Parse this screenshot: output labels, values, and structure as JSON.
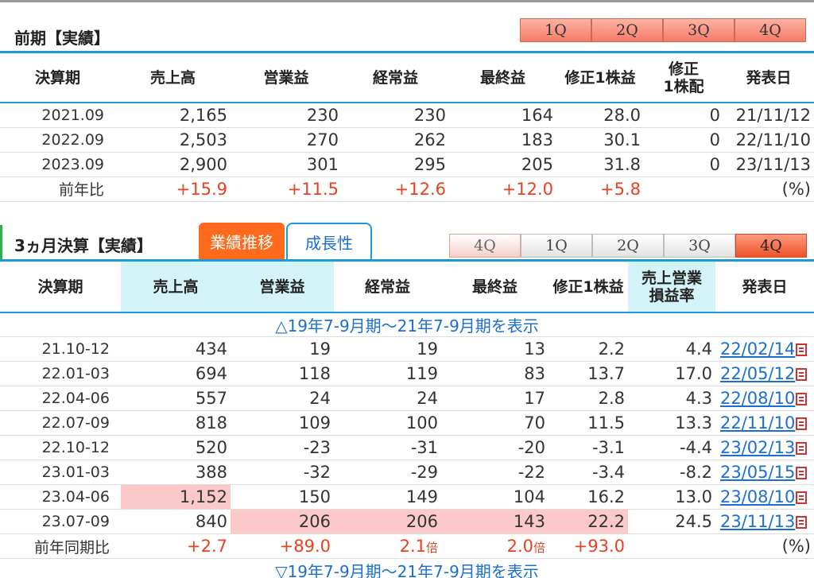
{
  "annual": {
    "title": "前期【実績】",
    "quarter_buttons": [
      "1Q",
      "2Q",
      "3Q",
      "4Q"
    ],
    "headers": [
      "決算期",
      "売上高",
      "営業益",
      "経常益",
      "最終益",
      "修正1株益",
      "修正\n1株配",
      "発表日"
    ],
    "rows": [
      [
        "2021.09",
        "2,165",
        "230",
        "230",
        "164",
        "28.0",
        "0",
        "21/11/12"
      ],
      [
        "2022.09",
        "2,503",
        "270",
        "262",
        "183",
        "30.1",
        "0",
        "22/11/10"
      ],
      [
        "2023.09",
        "2,900",
        "301",
        "295",
        "205",
        "31.8",
        "0",
        "23/11/13"
      ]
    ],
    "yoy": {
      "label": "前年比",
      "values": [
        "+15.9",
        "+11.5",
        "+12.6",
        "+12.0",
        "+5.8",
        "",
        "(%)"
      ]
    }
  },
  "quarterly": {
    "title": "3ヵ月決算【実績】",
    "tabs": {
      "active": "業績推移",
      "inactive": "成長性"
    },
    "quarter_buttons": [
      "4Q",
      "1Q",
      "2Q",
      "3Q",
      "4Q"
    ],
    "headers": [
      "決算期",
      "売上高",
      "営業益",
      "経常益",
      "最終益",
      "修正1株益",
      "売上営業\n損益率",
      "発表日"
    ],
    "show_earlier": "△19年7-9月期～21年7-9月期を表示",
    "rows": [
      [
        "21.10-12",
        "434",
        "19",
        "19",
        "13",
        "2.2",
        "4.4",
        "22/02/14"
      ],
      [
        "22.01-03",
        "694",
        "118",
        "119",
        "83",
        "13.7",
        "17.0",
        "22/05/12"
      ],
      [
        "22.04-06",
        "557",
        "24",
        "24",
        "17",
        "2.8",
        "4.3",
        "22/08/10"
      ],
      [
        "22.07-09",
        "818",
        "109",
        "100",
        "70",
        "11.5",
        "13.3",
        "22/11/10"
      ],
      [
        "22.10-12",
        "520",
        "-23",
        "-31",
        "-20",
        "-3.1",
        "-4.4",
        "23/02/13"
      ],
      [
        "23.01-03",
        "388",
        "-32",
        "-29",
        "-22",
        "-3.4",
        "-8.2",
        "23/05/15"
      ],
      [
        "23.04-06",
        "1,152",
        "150",
        "149",
        "104",
        "16.2",
        "13.0",
        "23/08/10"
      ],
      [
        "23.07-09",
        "840",
        "206",
        "206",
        "143",
        "22.2",
        "24.5",
        "23/11/13"
      ]
    ],
    "yoy": {
      "label": "前年同期比",
      "values": [
        "+2.7",
        "+89.0",
        "2.1",
        "2.0",
        "+93.0",
        "",
        "(%)"
      ],
      "multiplier_unit": "倍"
    },
    "show_later": "▽19年7-9月期～21年7-9月期を表示"
  },
  "colors": {
    "accent_red": "#e8411f",
    "highlight_pink": "#fbc9c9",
    "header_cyan": "#d4f3f8",
    "link_blue": "#1a6fd1",
    "tab_orange": "#ff6a1d"
  },
  "icons": {
    "pdf": "pdf-icon"
  }
}
